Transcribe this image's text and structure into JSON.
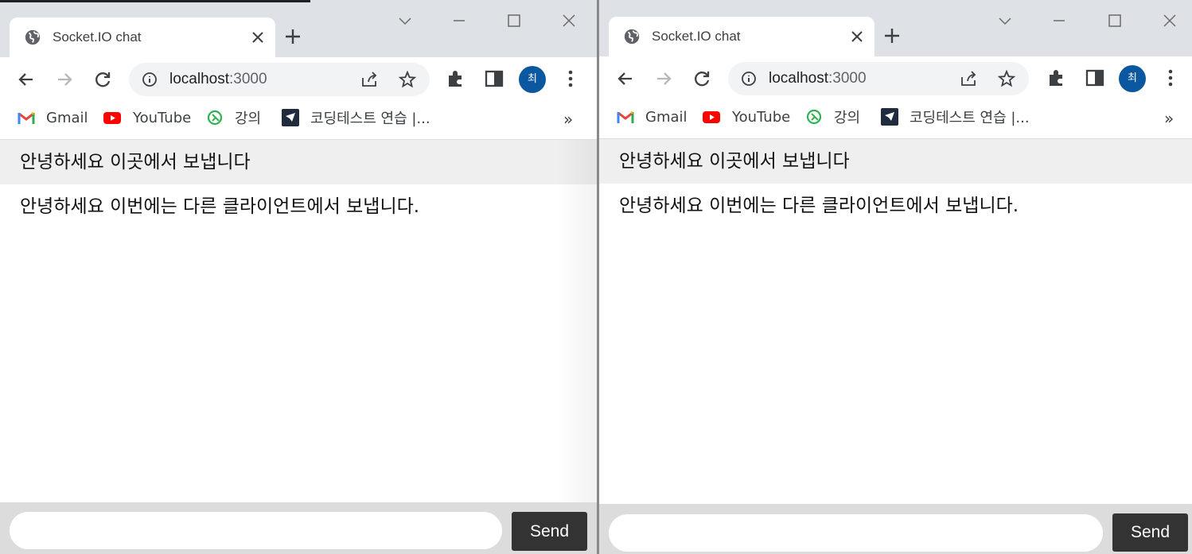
{
  "tab": {
    "title": "Socket.IO chat"
  },
  "address": {
    "host": "localhost",
    "port": ":3000"
  },
  "bookmarks": [
    {
      "label": "Gmail",
      "icon": "gmail-icon"
    },
    {
      "label": "YouTube",
      "icon": "youtube-icon"
    },
    {
      "label": "강의",
      "icon": "lecture-icon"
    },
    {
      "label": "코딩테스트 연습 |...",
      "icon": "programmers-icon"
    }
  ],
  "bookmarks_more": "»",
  "profile": {
    "initial": "최",
    "color": "#0b57a0"
  },
  "messages": [
    "안녕하세요 이곳에서 보냅니다",
    "안녕하세요 이번에는 다른 클라이언트에서 보냅니다."
  ],
  "form": {
    "input_value": "",
    "send_label": "Send"
  },
  "colors": {
    "titlebar": "#dee1e6",
    "message_alt_bg": "#efefef",
    "form_bg": "#dcdcdc",
    "send_button": "#333333"
  }
}
